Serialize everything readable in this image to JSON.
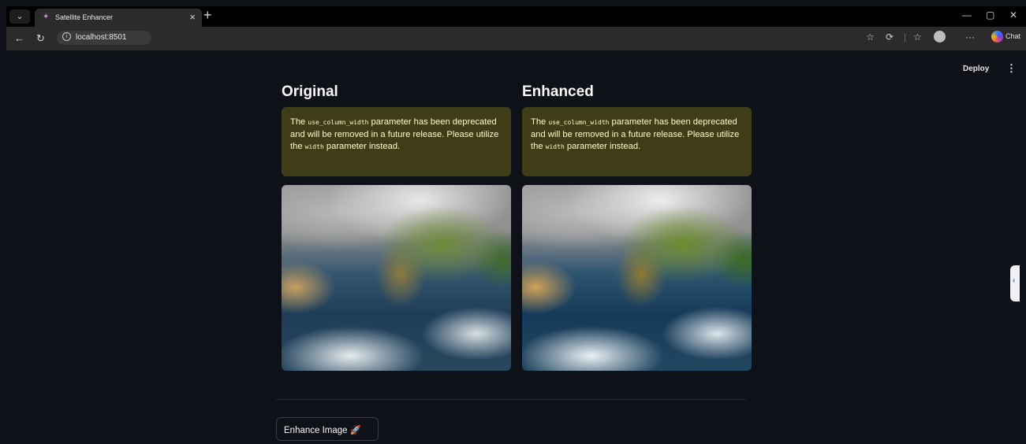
{
  "browser": {
    "tab_title": "Satellite Enhancer",
    "url": "localhost:8501",
    "chat_label": "Chat"
  },
  "app": {
    "deploy_label": "Deploy",
    "columns": [
      {
        "title": "Original",
        "warning": {
          "pre": "The ",
          "code1": "use_column_width",
          "mid": " parameter has been deprecated and will be removed in a future release. Please utilize the ",
          "code2": "width",
          "post": " parameter instead."
        }
      },
      {
        "title": "Enhanced",
        "warning": {
          "pre": "The ",
          "code1": "use_column_width",
          "mid": " parameter has been deprecated and will be removed in a future release. Please utilize the ",
          "code2": "width",
          "post": " parameter instead."
        }
      }
    ],
    "enhance_button": "Enhance Image 🚀"
  }
}
